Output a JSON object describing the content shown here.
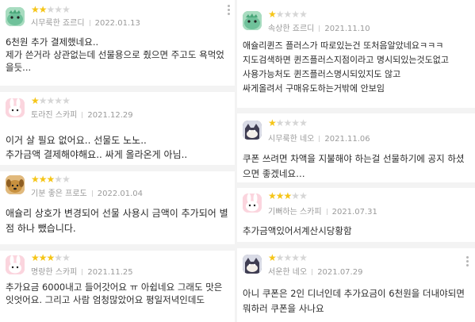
{
  "reviews_left": [
    {
      "rating": 2,
      "author": "시무룩한 죠르디",
      "date": "2022.01.13",
      "avatar": "jordy-dinosaur",
      "text": "6천원 추가 결제했네요..\n제가 쓴거라 상관없는데 선물용으로 줬으면 주고도 욕먹었을듯..."
    },
    {
      "rating": 1,
      "author": "토라진 스카피",
      "date": "2021.12.29",
      "avatar": "scappy-rabbit",
      "text": "이거 살 필요 없어요.. 선물도 노노..\n추가금액 결제해야해요.. 싸게 올라온게 아님.."
    },
    {
      "rating": 3,
      "author": "기분 좋은 프로도",
      "date": "2022.01.04",
      "avatar": "frodo-dog",
      "text": "애슐리 상호가 변경되어 선물 사용시 금액이 추가되어 별점 하나 뺐습니다."
    },
    {
      "rating": 3,
      "author": "명랑한 스카피",
      "date": "2021.11.25",
      "avatar": "scappy-rabbit",
      "text": "추가요금 6000내고 들어갓어요 ㅠ 아쉽네요 그래도 맛은 잇엇어요. 그리고 사람 엄청많았어요 평일저녁인데도"
    }
  ],
  "reviews_right": [
    {
      "rating": 1,
      "author": "속상한 죠르디",
      "date": "2021.11.10",
      "avatar": "jordy-dinosaur",
      "text": "애슐리퀸즈 플러스가 따로있는건 또처음알았네요ㅋㅋㅋ\n지도검색하면 퀸즈플러스지점이라고 명시되있는것도없고\n사용가능처도 퀸즈플러스명시되있지도 않고\n싸게올려서 구매유도하는거밖에 안보임"
    },
    {
      "rating": 1,
      "author": "시무룩한 네오",
      "date": "2021.11.06",
      "avatar": "neo-cat",
      "text": "쿠폰 쓰려면 차액을 지불해야 하는걸 선물하기에 공지 하셨으면 좋겠네요…"
    },
    {
      "rating": 3,
      "author": "기뻐하는 스카피",
      "date": "2021.07.31",
      "avatar": "scappy-rabbit",
      "text": "추가금액있어서계산시당황함"
    },
    {
      "rating": 1,
      "author": "서운한 네오",
      "date": "2021.07.29",
      "avatar": "neo-cat",
      "text": "아니 쿠폰은 2인 디너인데 추가요금이 6천원을 더내야되면 뭐하러 쿠폰을 사나요"
    }
  ],
  "colors": {
    "star_filled": "#f5c518",
    "star_empty": "#d6d6d6",
    "meta_text": "#9a9a9a",
    "body_text": "#2b2b2b"
  }
}
